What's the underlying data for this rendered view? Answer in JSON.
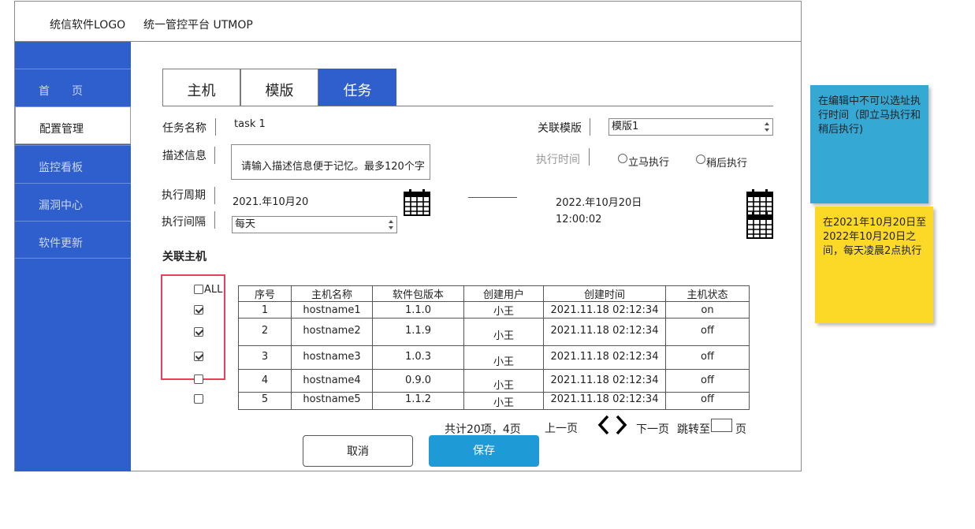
{
  "header": {
    "logo": "统信软件LOGO",
    "title": "统一管控平台 UTMOP"
  },
  "sidebar": {
    "items": [
      {
        "label": "首　　页",
        "active": false
      },
      {
        "label": "配置管理",
        "active": true
      },
      {
        "label": "监控看板",
        "active": false
      },
      {
        "label": "漏洞中心",
        "active": false
      },
      {
        "label": "软件更新",
        "active": false
      }
    ]
  },
  "tabs": [
    {
      "label": "主机",
      "active": false
    },
    {
      "label": "模版",
      "active": false
    },
    {
      "label": "任务",
      "active": true
    }
  ],
  "form": {
    "task_name_label": "任务名称",
    "task_name_value": "task 1",
    "template_label": "关联模版",
    "template_value": "模版1",
    "desc_label": "描述信息",
    "desc_placeholder": "请输入描述信息便于记忆。最多120个字",
    "exec_time_label": "执行时间",
    "radio_now": "立马执行",
    "radio_later": "稍后执行",
    "period_label": "执行周期",
    "start_date": "2021.年10月20",
    "end_date": "2022.年10月20日",
    "end_time": "12:00:02",
    "interval_label": "执行间隔",
    "interval_value": "每天"
  },
  "hosts": {
    "section_title": "关联主机",
    "all_label": "ALL",
    "columns": [
      "序号",
      "主机名称",
      "软件包版本",
      "创建用户",
      "创建时间",
      "主机状态"
    ],
    "rows": [
      {
        "no": "1",
        "name": "hostname1",
        "version": "1.1.0",
        "user": "小王",
        "time": "2021.11.18 02:12:34",
        "status": "on",
        "checked": true
      },
      {
        "no": "2",
        "name": "hostname2",
        "version": "1.1.9",
        "user": "小王",
        "time": "2021.11.18 02:12:34",
        "status": "off",
        "checked": true
      },
      {
        "no": "3",
        "name": "hostname3",
        "version": "1.0.3",
        "user": "小王",
        "time": "2021.11.18 02:12:34",
        "status": "off",
        "checked": true
      },
      {
        "no": "4",
        "name": "hostname4",
        "version": "0.9.0",
        "user": "小王",
        "time": "2021.11.18 02:12:34",
        "status": "off",
        "checked": false
      },
      {
        "no": "5",
        "name": "hostname5",
        "version": "1.1.2",
        "user": "小王",
        "time": "2021.11.18 02:12:34",
        "status": "off",
        "checked": false
      }
    ]
  },
  "pagination": {
    "summary": "共计20项，4页",
    "prev": "上一页",
    "next": "下一页",
    "jump_label": "跳转至",
    "page_suffix": "页"
  },
  "buttons": {
    "cancel": "取消",
    "save": "保存"
  },
  "notes": {
    "blue": "在编辑中不可以选址执行时间（即立马执行和稍后执行)",
    "yellow": "在2021年10月20日至2022年10月20日之间，每天凌晨2点执行"
  },
  "colors": {
    "sidebar": "#2f5fcc",
    "tab_active": "#2f5fcc",
    "save": "#1e9bd7",
    "note_blue": "#36a8d4",
    "note_yellow": "#fbd926",
    "highlight": "#e8405a"
  }
}
